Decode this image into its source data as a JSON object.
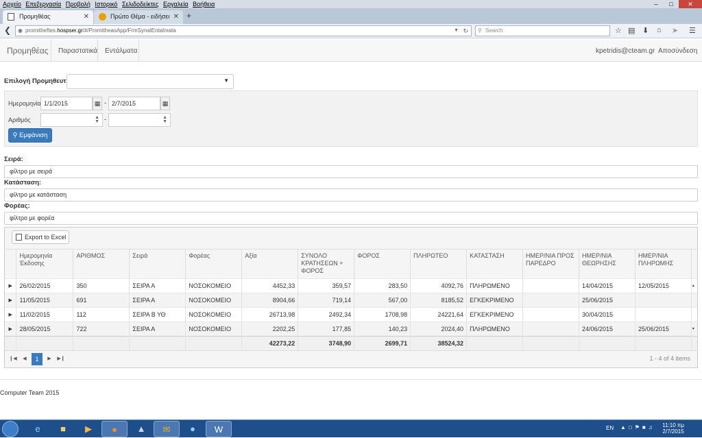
{
  "browser": {
    "menu": [
      "Αρχείο",
      "Επεξεργασία",
      "Προβολή",
      "Ιστορικό",
      "Σελιδοδείκτες",
      "Εργαλεία",
      "Βοήθεια"
    ],
    "tabs": [
      {
        "title": "Προμηθέας"
      },
      {
        "title": "Πρώτο Θέμα - ειδήσεις απ..."
      }
    ],
    "url_prefix": "promitheftes.",
    "url_host": "hospser.gr",
    "url_rest": "/#/PromitheasApp/FrmSynalEntalmata",
    "search_placeholder": "Search"
  },
  "app": {
    "brand": "Προμηθέας",
    "nav": [
      "Παραστατικά",
      "Εντάλματα"
    ],
    "user": "kpetridis@cteam.gr",
    "logout": "Αποσύνδεση"
  },
  "filters": {
    "supplier_label": "Επιλογή Προμηθευτή",
    "supplier_value": "",
    "date_label": "Ημερομηνία",
    "date_from": "1/1/2015",
    "date_to": "2/7/2015",
    "number_label": "Αριθμός",
    "number_from": "",
    "number_to": "",
    "dash": "-",
    "show_button": "Εμφάνιση",
    "series_label": "Σειρά:",
    "series_placeholder": "φίλτρο με σειρά",
    "status_label": "Κατάσταση:",
    "status_placeholder": "φίλτρο με κατάσταση",
    "agency_label": "Φορέας:",
    "agency_placeholder": "φίλτρο με φορέα"
  },
  "grid": {
    "export_button": "Export to Excel",
    "columns": [
      "Ημερομηνία Έκδοσης",
      "ΑΡΙΘΜΟΣ",
      "Σειρά",
      "Φορέας",
      "Αξία",
      "ΣΥΝΟΛΟ ΚΡΑΤΗΣΕΩΝ + ΦΟΡΟΣ",
      "ΦΟΡΟΣ",
      "ΠΛΗΡΩΤΕΟ",
      "ΚΑΤΑΣΤΑΣΗ",
      "ΗΜΕΡ/ΝΙΑ ΠΡΟΣ ΠΑΡΕΔΡΟ",
      "ΗΜΕΡ/ΝΙΑ ΘΕΩΡΗΣΗΣ",
      "ΗΜΕΡ/ΝΙΑ ΠΛΗΡΩΜΗΣ"
    ],
    "rows": [
      [
        "26/02/2015",
        "350",
        "ΣΕΙΡΑ Α",
        "ΝΟΣΟΚΟΜΕΙΟ",
        "4452,33",
        "359,57",
        "283,50",
        "4092,76",
        "ΠΛΗΡΩΜΕΝΟ",
        "",
        "14/04/2015",
        "12/05/2015"
      ],
      [
        "11/05/2015",
        "691",
        "ΣΕΙΡΑ Α",
        "ΝΟΣΟΚΟΜΕΙΟ",
        "8904,66",
        "719,14",
        "567,00",
        "8185,52",
        "ΕΓΚΕΚΡΙΜΕΝΟ",
        "",
        "25/06/2015",
        ""
      ],
      [
        "11/02/2015",
        "112",
        "ΣΕΙΡΑ Β ΥΘ",
        "ΝΟΣΟΚΟΜΕΙΟ",
        "26713,98",
        "2492,34",
        "1708,98",
        "24221,64",
        "ΕΓΚΕΚΡΙΜΕΝΟ",
        "",
        "30/04/2015",
        ""
      ],
      [
        "28/05/2015",
        "722",
        "ΣΕΙΡΑ Α",
        "ΝΟΣΟΚΟΜΕΙΟ",
        "2202,25",
        "177,85",
        "140,23",
        "2024,40",
        "ΠΛΗΡΩΜΕΝΟ",
        "",
        "24/06/2015",
        "25/06/2015"
      ]
    ],
    "totals": [
      "",
      "",
      "",
      "",
      "42273,22",
      "3748,90",
      "2699,71",
      "38524,32",
      "",
      "",
      "",
      ""
    ],
    "current_page": "1",
    "page_info": "1 - 4 of 4 items"
  },
  "footer": "Computer Team 2015",
  "taskbar": {
    "lang": "EN",
    "time": "11:10 πμ",
    "date": "2/7/2015"
  }
}
